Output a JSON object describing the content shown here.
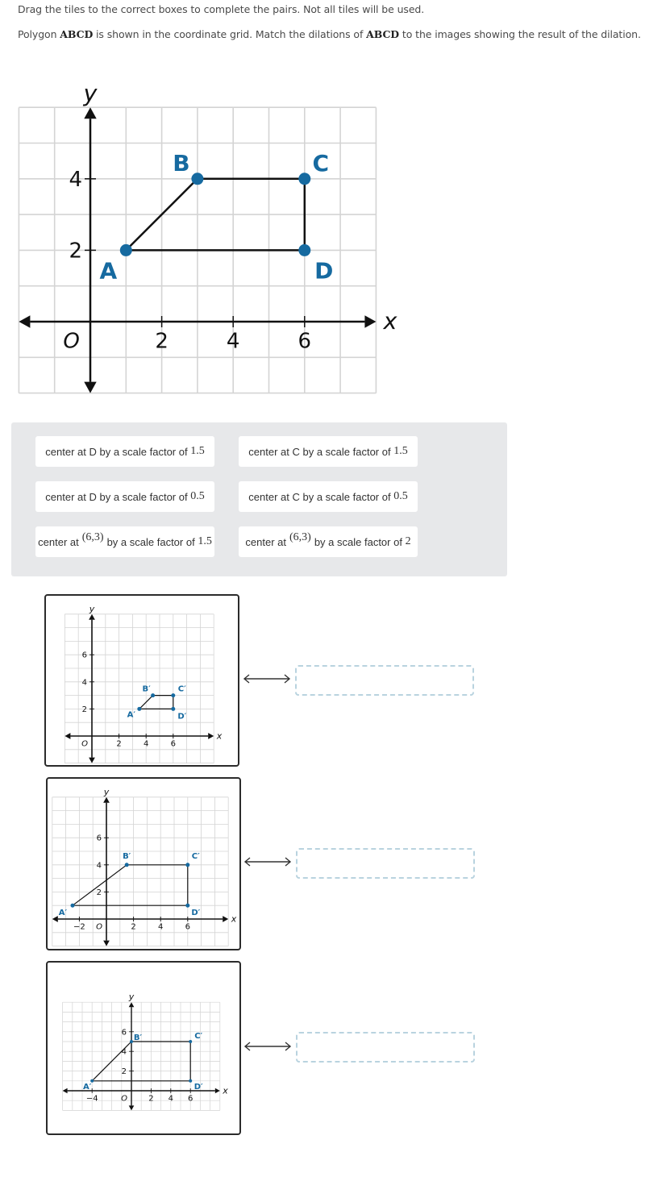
{
  "instructions": {
    "line1": "Drag the tiles to the correct boxes to complete the pairs. Not all tiles will be used.",
    "line2_pre": "Polygon ",
    "line2_poly1": "ABCD",
    "line2_mid": " is shown in the coordinate grid. Match the dilations of ",
    "line2_poly2": "ABCD",
    "line2_post": " to the images showing the result of the dilation."
  },
  "colors": {
    "point_blue": "#166aa0",
    "grid": "#d4d4d4",
    "tile_bank_bg": "#e7e8ea",
    "drop_border": "#b9d3df"
  },
  "main_graph": {
    "x_label": "x",
    "y_label": "y",
    "origin_label": "O",
    "x_ticks": [
      "2",
      "4",
      "6"
    ],
    "y_ticks": [
      "2",
      "4"
    ],
    "points": [
      {
        "label": "A",
        "x": 1,
        "y": 2
      },
      {
        "label": "B",
        "x": 3,
        "y": 4
      },
      {
        "label": "C",
        "x": 6,
        "y": 4
      },
      {
        "label": "D",
        "x": 6,
        "y": 2
      }
    ]
  },
  "tiles": [
    {
      "pre": "center at D by a scale factor of ",
      "num": "1.5"
    },
    {
      "pre": "center at C by a scale factor of ",
      "num": "1.5"
    },
    {
      "pre": "center at D by a scale factor of ",
      "num": "0.5"
    },
    {
      "pre": "center at C by a scale factor of ",
      "num": "0.5"
    },
    {
      "pre": "center at ",
      "point": "(6,3)",
      "post": " by a scale factor of ",
      "num": "1.5"
    },
    {
      "pre": "center at ",
      "point": "(6,3)",
      "post": " by a scale factor of ",
      "num": "2"
    }
  ],
  "answer_graphs": [
    {
      "x_label": "x",
      "y_label": "y",
      "origin_label": "O",
      "x_ticks": [
        "2",
        "4",
        "6"
      ],
      "y_ticks": [
        "2",
        "4",
        "6"
      ],
      "points": [
        {
          "label": "A′",
          "x": 3.5,
          "y": 2
        },
        {
          "label": "B′",
          "x": 4.5,
          "y": 3
        },
        {
          "label": "C′",
          "x": 6,
          "y": 3
        },
        {
          "label": "D′",
          "x": 6,
          "y": 2
        }
      ],
      "drop_value": ""
    },
    {
      "x_label": "x",
      "y_label": "y",
      "origin_label": "O",
      "x_ticks": [
        "−2",
        "2",
        "4",
        "6"
      ],
      "y_ticks": [
        "2",
        "4",
        "6"
      ],
      "points": [
        {
          "label": "A′",
          "x": -2.5,
          "y": 1
        },
        {
          "label": "B′",
          "x": 1.5,
          "y": 4
        },
        {
          "label": "C′",
          "x": 6,
          "y": 4
        },
        {
          "label": "D′",
          "x": 6,
          "y": 1
        }
      ],
      "drop_value": ""
    },
    {
      "x_label": "x",
      "y_label": "y",
      "origin_label": "O",
      "x_ticks": [
        "−4",
        "2",
        "4",
        "6"
      ],
      "y_ticks": [
        "2",
        "4",
        "6"
      ],
      "points": [
        {
          "label": "A′",
          "x": -4,
          "y": 1
        },
        {
          "label": "B′",
          "x": 0,
          "y": 5
        },
        {
          "label": "C′",
          "x": 6,
          "y": 5
        },
        {
          "label": "D′",
          "x": 6,
          "y": 1
        }
      ],
      "drop_value": ""
    }
  ]
}
